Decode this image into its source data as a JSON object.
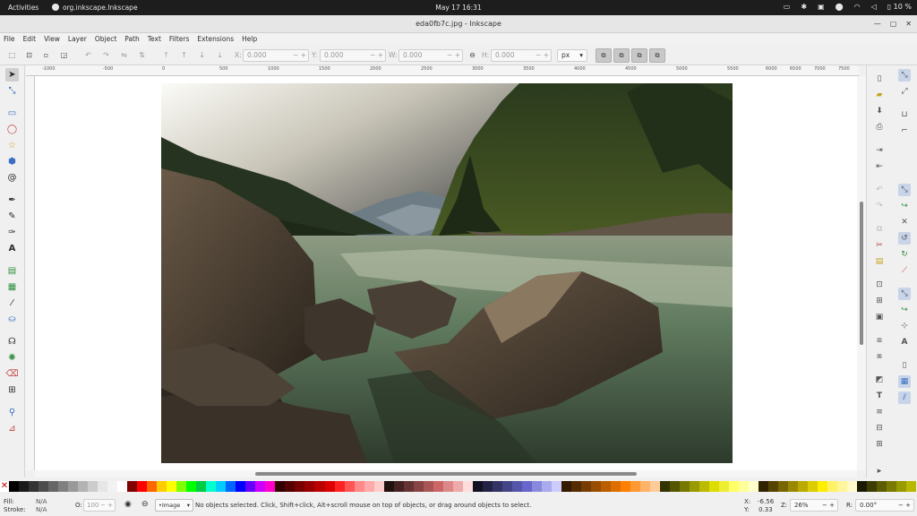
{
  "topbar": {
    "activities": "Activities",
    "app_name": "org.inkscape.Inkscape",
    "clock": "May 17  16:31",
    "battery": "10 %"
  },
  "window": {
    "title": "eda0fb7c.jpg - Inkscape"
  },
  "menu": [
    "File",
    "Edit",
    "View",
    "Layer",
    "Object",
    "Path",
    "Text",
    "Filters",
    "Extensions",
    "Help"
  ],
  "toolbar": {
    "x_label": "X:",
    "x_value": "0.000",
    "y_label": "Y:",
    "y_value": "0.000",
    "w_label": "W:",
    "w_value": "0.000",
    "h_label": "H:",
    "h_value": "0.000",
    "unit": "px"
  },
  "ruler": {
    "labels": [
      "-1000",
      "-500",
      "0",
      "500",
      "1000",
      "1500",
      "2000",
      "2500",
      "3000",
      "3500",
      "4000",
      "4500",
      "5000",
      "5500",
      "6000",
      "6500",
      "7000",
      "7500"
    ]
  },
  "palette": [
    "#000000",
    "#1a1a1a",
    "#333333",
    "#4d4d4d",
    "#666666",
    "#808080",
    "#999999",
    "#b3b3b3",
    "#cccccc",
    "#e6e6e6",
    "#f2f2f2",
    "#ffffff",
    "#800000",
    "#ff0000",
    "#ff6600",
    "#ffcc00",
    "#ffff00",
    "#80ff00",
    "#00ff00",
    "#00cc44",
    "#00ffcc",
    "#00ccff",
    "#0066ff",
    "#0000ff",
    "#6600ff",
    "#cc00ff",
    "#ff00cc",
    "#330000",
    "#550000",
    "#770000",
    "#990000",
    "#bb0000",
    "#dd0000",
    "#ff2222",
    "#ff5555",
    "#ff8888",
    "#ffaaaa",
    "#ffcccc",
    "#221111",
    "#442222",
    "#663333",
    "#884444",
    "#aa5555",
    "#cc6666",
    "#dd8888",
    "#eeaaaa",
    "#ffdddd",
    "#111122",
    "#222244",
    "#333366",
    "#444488",
    "#5555aa",
    "#6666cc",
    "#8888dd",
    "#aaaaee",
    "#ccccff",
    "#331a00",
    "#552b00",
    "#773c00",
    "#994d00",
    "#bb5e00",
    "#dd6f00",
    "#ff8000",
    "#ff9933",
    "#ffb366",
    "#ffcc99",
    "#333300",
    "#555500",
    "#777700",
    "#999900",
    "#bbbb00",
    "#dddd00",
    "#eeee33",
    "#ffff66",
    "#ffff99",
    "#ffffcc",
    "#332200",
    "#554400",
    "#776600",
    "#998800",
    "#bbaa00",
    "#ddcc00",
    "#ffee00",
    "#fff266",
    "#fff599",
    "#fff9cc",
    "#1a1a00",
    "#3d3d00",
    "#5c5c00",
    "#7a7a00",
    "#999900",
    "#b8b800"
  ],
  "status": {
    "fill_label": "Fill:",
    "fill_value": "N/A",
    "stroke_label": "Stroke:",
    "stroke_value": "N/A",
    "opacity_label": "O:",
    "opacity_value": "100",
    "layer": "•Image",
    "message": "No objects selected. Click, Shift+click, Alt+scroll mouse on top of objects, or drag around objects to select.",
    "x_label": "X:",
    "x_value": "-6.56",
    "y_label": "Y:",
    "y_value": "0.33",
    "zoom_label": "Z:",
    "zoom_value": "26%",
    "rotate_label": "R:",
    "rotate_value": "0.00°"
  }
}
